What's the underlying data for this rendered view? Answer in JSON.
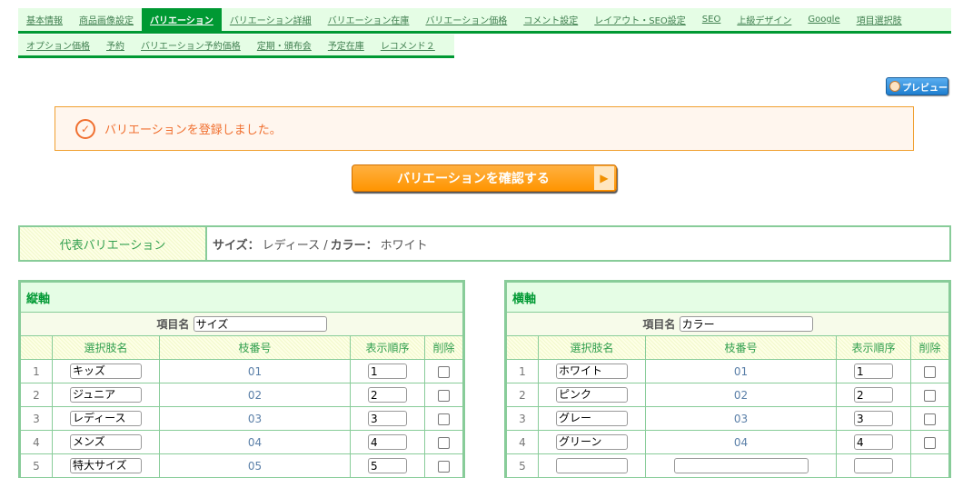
{
  "tabs_row1": [
    {
      "label": "基本情報"
    },
    {
      "label": "商品画像設定"
    },
    {
      "label": "バリエーション",
      "active": true
    },
    {
      "label": "バリエーション詳細"
    },
    {
      "label": "バリエーション在庫"
    },
    {
      "label": "バリエーション価格"
    },
    {
      "label": "コメント設定"
    },
    {
      "label": "レイアウト・SEO設定"
    },
    {
      "label": "SEO"
    },
    {
      "label": "上級デザイン"
    },
    {
      "label": "Google"
    },
    {
      "label": "項目選択肢"
    }
  ],
  "tabs_row2": [
    {
      "label": "オプション価格"
    },
    {
      "label": "予約"
    },
    {
      "label": "バリエーション予約価格"
    },
    {
      "label": "定期・頒布会"
    },
    {
      "label": "予定在庫"
    },
    {
      "label": "レコメンド２"
    }
  ],
  "preview_label": "プレビュー",
  "notice": "バリエーションを登録しました。",
  "confirm_label": "バリエーションを確認する",
  "representative": {
    "label": "代表バリエーション",
    "k1": "サイズ：",
    "v1": "レディース /",
    "k2": "カラー：",
    "v2": "ホワイト"
  },
  "columns": {
    "choice": "選択肢名",
    "code": "枝番号",
    "order": "表示順序",
    "delete": "削除"
  },
  "item_name_label": "項目名",
  "axes": {
    "vertical": {
      "title": "縦軸",
      "item_name": "サイズ",
      "rows": [
        {
          "no": "1",
          "name": "キッズ",
          "code": "01",
          "order": "1"
        },
        {
          "no": "2",
          "name": "ジュニア",
          "code": "02",
          "order": "2"
        },
        {
          "no": "3",
          "name": "レディース",
          "code": "03",
          "order": "3"
        },
        {
          "no": "4",
          "name": "メンズ",
          "code": "04",
          "order": "4"
        },
        {
          "no": "5",
          "name": "特大サイズ",
          "code": "05",
          "order": "5"
        }
      ]
    },
    "horizontal": {
      "title": "横軸",
      "item_name": "カラー",
      "rows": [
        {
          "no": "1",
          "name": "ホワイト",
          "code": "01",
          "order": "1"
        },
        {
          "no": "2",
          "name": "ピンク",
          "code": "02",
          "order": "2"
        },
        {
          "no": "3",
          "name": "グレー",
          "code": "03",
          "order": "3"
        },
        {
          "no": "4",
          "name": "グリーン",
          "code": "04",
          "order": "4"
        },
        {
          "no": "5",
          "name": "",
          "code": "",
          "order": "",
          "empty": true
        }
      ]
    }
  },
  "colors": {
    "tab_active": "#009933",
    "tab_bg": "#e5fde5",
    "notice": "#f07030",
    "border": "#88cc99"
  }
}
